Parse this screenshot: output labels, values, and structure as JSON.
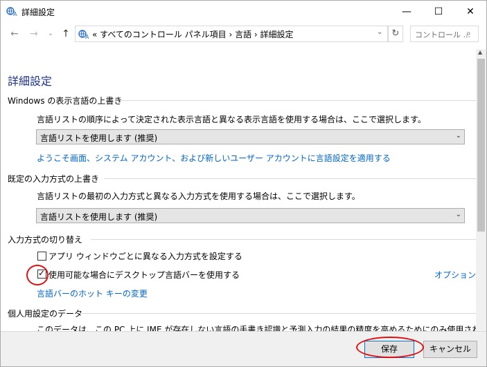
{
  "window": {
    "title": "詳細設定",
    "min_label": "—",
    "max_label": "☐",
    "close_label": "✕"
  },
  "address": {
    "path": "«  すべてのコントロール パネル項目  ›  言語  ›  詳細設定",
    "search_placeholder": "コントロール ...",
    "back": "←",
    "forward": "→",
    "history": "⌄",
    "up": "↑",
    "dropdown": "⌄",
    "refresh": "↻",
    "search_icon": "⌕"
  },
  "content": {
    "page_title": "詳細設定",
    "display_override": {
      "heading": "Windows の表示言語の上書き",
      "description": "言語リストの順序によって決定された表示言語と異なる表示言語を使用する場合は、ここで選択します。",
      "select_value": "言語リストを使用します (推奨)",
      "apply_link": "ようこそ画面、システム アカウント、および新しいユーザー アカウントに言語設定を適用する"
    },
    "input_override": {
      "heading": "既定の入力方式の上書き",
      "description": "言語リストの最初の入力方式と異なる入力方式を使用する場合は、ここで選択します。",
      "select_value": "言語リストを使用します (推奨)"
    },
    "switching": {
      "heading": "入力方式の切り替え",
      "per_app_label": "アプリ ウィンドウごとに異なる入力方式を設定する",
      "per_app_checked": false,
      "langbar_label": "使用可能な場合にデスクトップ言語バーを使用する",
      "langbar_checked": true,
      "options_link": "オプション",
      "hotkey_link": "言語バーのホット キーの変更"
    },
    "personal": {
      "heading": "個人用設定のデータ",
      "description": "このデータは、この PC 上に IME が存在しない言語の手書き認識と予測入力の結果の精度を高めるためにのみ使用されます。情報が"
    }
  },
  "buttons": {
    "save": "保存",
    "cancel": "キャンセル"
  },
  "colors": {
    "link": "#0066cc",
    "title": "#1e3287",
    "annotation": "#e01010"
  }
}
